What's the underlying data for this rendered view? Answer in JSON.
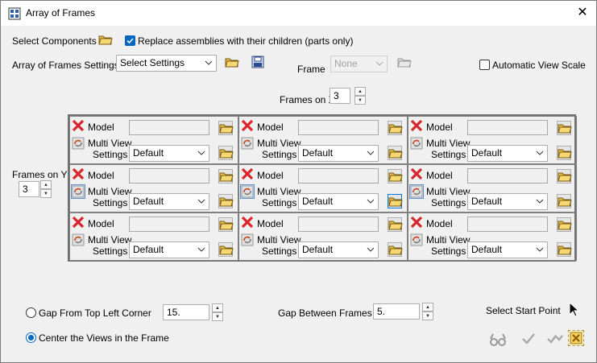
{
  "window": {
    "title": "Array of Frames",
    "close_glyph": "✕"
  },
  "select_components": {
    "label": "Select Components"
  },
  "replace_assemblies": {
    "label": "Replace assemblies with their children (parts only)",
    "checked": true
  },
  "array_settings": {
    "label": "Array of Frames Settings",
    "value": "Select Settings"
  },
  "frame": {
    "label": "Frame",
    "value": "None"
  },
  "auto_view_scale": {
    "label": "Automatic View Scale",
    "checked": false
  },
  "frames_on_x": {
    "label": "Frames on X",
    "value": "3"
  },
  "frames_on_y": {
    "label": "Frames on Y",
    "value": "3"
  },
  "cell_text": {
    "model": "Model",
    "multi_view": "Multi View",
    "settings": "Settings",
    "default_value": "Default"
  },
  "gap_top_left": {
    "label": "Gap From Top Left Corner",
    "value": "15.",
    "selected": false
  },
  "center_views": {
    "label": "Center the Views in the Frame",
    "selected": true
  },
  "gap_between": {
    "label": "Gap Between Frames",
    "value": "5."
  },
  "start_point": {
    "label": "Select Start Point"
  },
  "colors": {
    "accent": "#0067c0",
    "red_x": "#d9262c",
    "folder": "#e8c14a"
  }
}
